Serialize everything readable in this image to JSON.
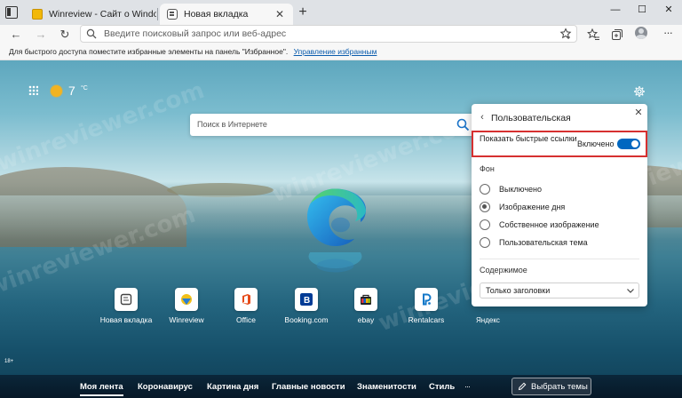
{
  "browser": {
    "tabs": [
      {
        "title": "Winreview - Сайт о Windows"
      },
      {
        "title": "Новая вкладка"
      }
    ],
    "window_controls": {
      "minimize": "—",
      "maximize": "☐",
      "close": "✕"
    },
    "address_placeholder": "Введите поисковый запрос или веб-адрес",
    "favorites_bar": {
      "text": "Для быстрого доступа поместите избранные элементы на панель \"Избранное\".",
      "link": "Управление избранным"
    }
  },
  "newtab": {
    "weather": {
      "temp": "7",
      "unit": "°C"
    },
    "search_placeholder": "Поиск в Интернете",
    "quick_links": [
      {
        "label": "Новая вкладка",
        "icon": "new-tab-icon"
      },
      {
        "label": "Winreview",
        "icon": "winreview-icon"
      },
      {
        "label": "Office",
        "icon": "office-icon"
      },
      {
        "label": "Booking.com",
        "icon": "booking-icon"
      },
      {
        "label": "ebay",
        "icon": "ebay-icon"
      },
      {
        "label": "Rentalcars",
        "icon": "rentalcars-icon"
      },
      {
        "label": "Яндекс",
        "icon": "yandex-icon"
      }
    ],
    "age_badge": "18+",
    "watermark": "winreviewer.com",
    "feed": {
      "tabs": [
        "Моя лента",
        "Коронавирус",
        "Картина дня",
        "Главные новости",
        "Знаменитости",
        "Стиль"
      ],
      "active": "Моя лента",
      "more": "···",
      "theme_button": "Выбрать темы"
    }
  },
  "customize_panel": {
    "title": "Пользовательская",
    "quick_links_label": "Показать быстрые ссылки",
    "quick_links_state": "Включено",
    "quick_links_enabled": true,
    "background_label": "Фон",
    "background_options": [
      "Выключено",
      "Изображение дня",
      "Собственное изображение",
      "Пользовательская тема"
    ],
    "background_selected": "Изображение дня",
    "content_label": "Содержимое",
    "content_value": "Только заголовки"
  },
  "colors": {
    "accent": "#0067c0",
    "highlight": "#d63030",
    "weather_sun": "#f2b321"
  }
}
